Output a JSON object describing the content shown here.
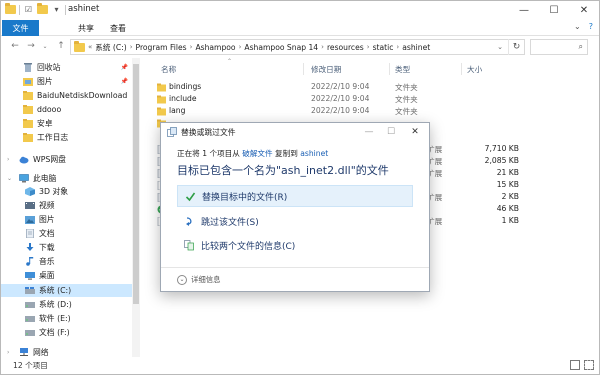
{
  "window": {
    "title": "ashinet"
  },
  "ribbon": {
    "tabs": [
      "文件",
      "共享",
      "查看"
    ]
  },
  "address": {
    "crumbs": [
      "系统 (C:)",
      "Program Files",
      "Ashampoo",
      "Ashampoo Snap 14",
      "resources",
      "static",
      "ashinet"
    ]
  },
  "sidebar": {
    "items": [
      {
        "label": "回收站",
        "icon": "recycle-bin-icon",
        "pinned": true
      },
      {
        "label": "图片",
        "icon": "pictures-folder-icon",
        "pinned": true
      },
      {
        "label": "BaiduNetdiskDownload",
        "icon": "folder-icon",
        "pinned": false
      },
      {
        "label": "ddooo",
        "icon": "folder-icon",
        "pinned": false
      },
      {
        "label": "安卓",
        "icon": "folder-icon",
        "pinned": false
      },
      {
        "label": "工作日志",
        "icon": "folder-icon",
        "pinned": false
      },
      {
        "label": "WPS网盘",
        "icon": "cloud-icon",
        "pinned": false
      },
      {
        "label": "此电脑",
        "icon": "computer-icon",
        "pinned": false
      },
      {
        "label": "3D 对象",
        "icon": "3d-objects-icon",
        "pinned": false
      },
      {
        "label": "视频",
        "icon": "videos-icon",
        "pinned": false
      },
      {
        "label": "图片",
        "icon": "pictures-icon",
        "pinned": false
      },
      {
        "label": "文档",
        "icon": "documents-icon",
        "pinned": false
      },
      {
        "label": "下载",
        "icon": "downloads-icon",
        "pinned": false
      },
      {
        "label": "音乐",
        "icon": "music-icon",
        "pinned": false
      },
      {
        "label": "桌面",
        "icon": "desktop-icon",
        "pinned": false
      },
      {
        "label": "系统 (C:)",
        "icon": "drive-c-icon",
        "pinned": false,
        "selected": true
      },
      {
        "label": "系统 (D:)",
        "icon": "drive-icon",
        "pinned": false
      },
      {
        "label": "软件 (E:)",
        "icon": "drive-icon",
        "pinned": false
      },
      {
        "label": "文档 (F:)",
        "icon": "drive-icon",
        "pinned": false
      },
      {
        "label": "网络",
        "icon": "network-icon",
        "pinned": false
      }
    ]
  },
  "filelist": {
    "columns": [
      "名称",
      "修改日期",
      "类型",
      "大小"
    ],
    "rows": [
      {
        "name": "bindings",
        "date": "2022/2/10 9:04",
        "type": "文件夹",
        "size": ""
      },
      {
        "name": "include",
        "date": "2022/2/10 9:04",
        "type": "文件夹",
        "size": ""
      },
      {
        "name": "lang",
        "date": "2022/2/10 9:04",
        "type": "文件夹",
        "size": ""
      },
      {
        "name": "",
        "date": "",
        "type": "",
        "size": ""
      },
      {
        "name": "",
        "date": "",
        "type": "扩展",
        "size": "7,710 KB"
      },
      {
        "name": "",
        "date": "",
        "type": "扩展",
        "size": "2,085 KB"
      },
      {
        "name": "",
        "date": "",
        "type": "扩展",
        "size": "21 KB"
      },
      {
        "name": "",
        "date": "",
        "type": "",
        "size": "15 KB"
      },
      {
        "name": "",
        "date": "",
        "type": "扩展",
        "size": "2 KB"
      },
      {
        "name": "",
        "date": "",
        "type": "",
        "size": "46 KB"
      },
      {
        "name": "",
        "date": "",
        "type": "扩展",
        "size": "1 KB"
      }
    ]
  },
  "status": {
    "count": "12 个项目"
  },
  "dialog": {
    "title": "替换或跳过文件",
    "line_prefix": "正在将 1 个项目从",
    "source": "破解文件",
    "line_mid": "复制到",
    "dest": "ashinet",
    "heading": "目标已包含一个名为\"ash_inet2.dll\"的文件",
    "options": [
      {
        "label": "替换目标中的文件(R)",
        "icon": "checkmark-icon"
      },
      {
        "label": "跳过该文件(S)",
        "icon": "skip-arrow-icon"
      },
      {
        "label": "比较两个文件的信息(C)",
        "icon": "compare-files-icon"
      }
    ],
    "details": "详细信息"
  },
  "colors": {
    "accent": "#1979ca",
    "selection": "#cce8ff",
    "dialog_text": "#1f3a6b",
    "link": "#1a5fb4"
  }
}
